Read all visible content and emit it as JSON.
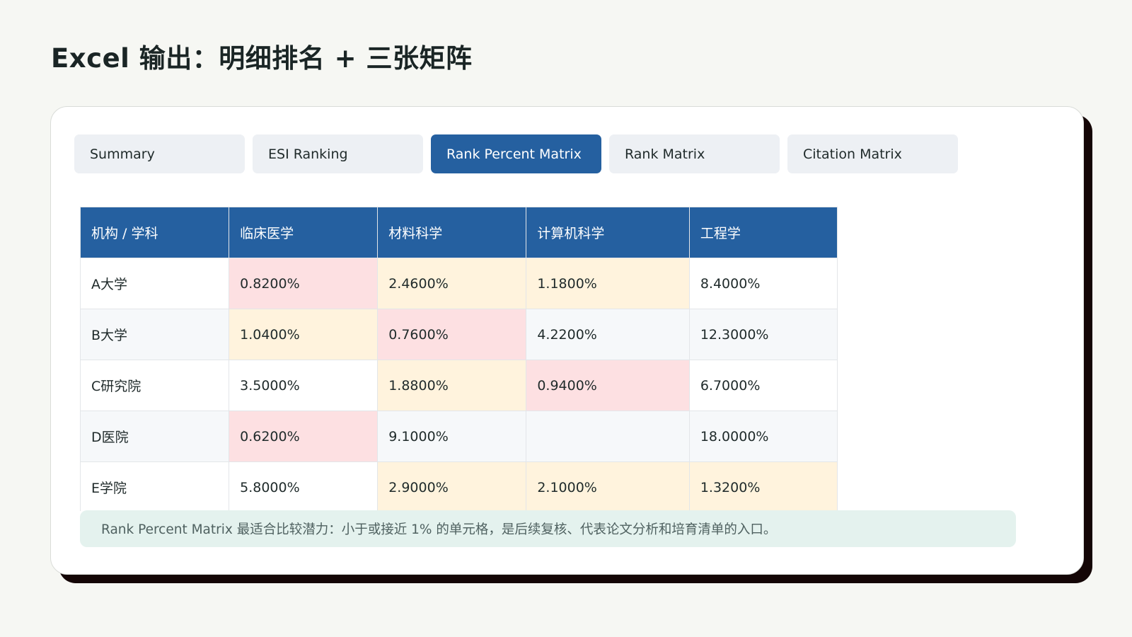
{
  "title": "Excel 输出：明细排名 + 三张矩阵",
  "tabs": [
    {
      "label": "Summary"
    },
    {
      "label": "ESI Ranking"
    },
    {
      "label": "Rank Percent Matrix"
    },
    {
      "label": "Rank Matrix"
    },
    {
      "label": "Citation Matrix"
    }
  ],
  "active_tab": "Rank Percent Matrix",
  "table": {
    "headers": [
      "机构 / 学科",
      "临床医学",
      "材料科学",
      "计算机科学",
      "工程学"
    ],
    "rows": [
      {
        "cells": [
          "A大学",
          "0.8200%",
          "2.4600%",
          "1.1800%",
          "8.4000%"
        ]
      },
      {
        "cells": [
          "B大学",
          "1.0400%",
          "0.7600%",
          "4.2200%",
          "12.3000%"
        ]
      },
      {
        "cells": [
          "C研究院",
          "3.5000%",
          "1.8800%",
          "0.9400%",
          "6.7000%"
        ]
      },
      {
        "cells": [
          "D医院",
          "0.6200%",
          "9.1000%",
          "",
          "18.0000%"
        ]
      },
      {
        "cells": [
          "E学院",
          "5.8000%",
          "2.9000%",
          "2.1000%",
          "1.3200%"
        ]
      }
    ]
  },
  "highlight_colors": {
    "red": "#fde0e2",
    "yellow": "#fff3dd",
    "header": "#2560a0"
  },
  "note": "Rank Percent Matrix 最适合比较潜力：小于或接近 1% 的单元格，是后续复核、代表论文分析和培育清单的入口。"
}
